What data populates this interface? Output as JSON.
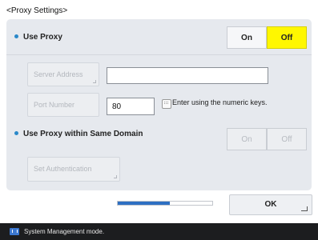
{
  "page": {
    "title": "<Proxy Settings>"
  },
  "use_proxy": {
    "label": "Use Proxy",
    "on_label": "On",
    "off_label": "Off",
    "selected": "Off"
  },
  "server_address": {
    "button_label": "Server Address",
    "value": ""
  },
  "port_number": {
    "button_label": "Port Number",
    "value": "80",
    "hint": "Enter using the numeric keys."
  },
  "same_domain": {
    "label": "Use Proxy within Same Domain",
    "on_label": "On",
    "off_label": "Off"
  },
  "set_authentication": {
    "label": "Set Authentication"
  },
  "progress": {
    "fraction": 0.55
  },
  "ok_button": {
    "label": "OK"
  },
  "status_bar": {
    "text": "System Management mode."
  },
  "colors": {
    "accent": "#fff700",
    "bullet": "#2a88c9",
    "progress": "#2e6fc2"
  }
}
